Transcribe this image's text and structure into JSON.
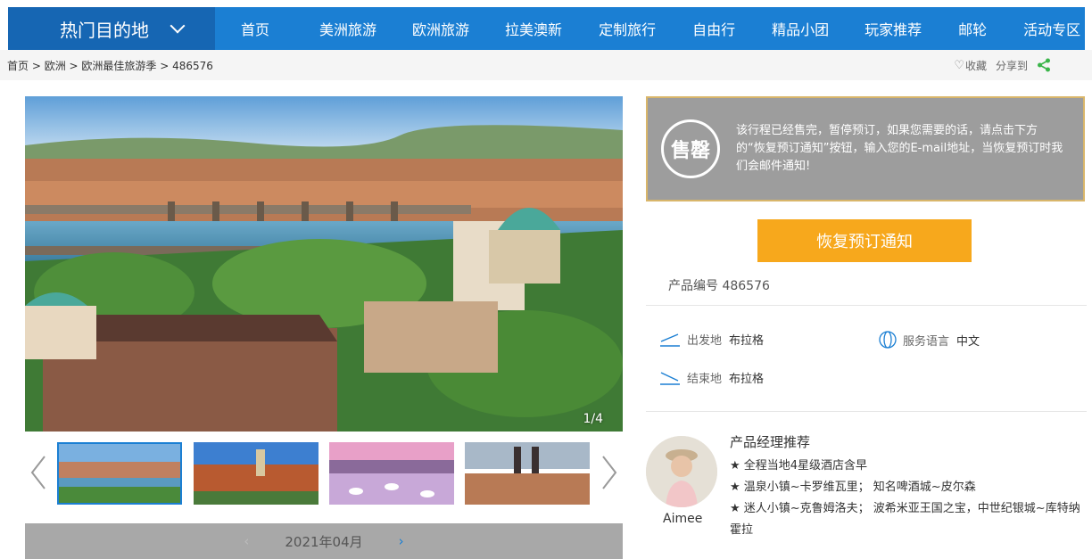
{
  "nav": {
    "brand": "热门目的地",
    "items": [
      "首页",
      "美洲旅游",
      "欧洲旅游",
      "拉美澳新",
      "定制旅行",
      "自由行",
      "精品小团",
      "玩家推荐",
      "邮轮",
      "活动专区"
    ]
  },
  "breadcrumb": {
    "home": "首页",
    "sep": " > ",
    "level1": "欧洲",
    "level2": "欧洲最佳旅游季",
    "current": "486576"
  },
  "actions": {
    "favorite": "收藏",
    "share": "分享到"
  },
  "gallery": {
    "counter": "1/4",
    "thumbnail_count": 4,
    "active_thumbnail": 1
  },
  "calendar": {
    "month": "2021年04月",
    "prev": "‹",
    "next": "›"
  },
  "soldout": {
    "stamp": "售罄",
    "message": "该行程已经售完，暂停预订，如果您需要的话，请点击下方的“恢复预订通知”按钮，输入您的E-mail地址，当恢复预订时我们会邮件通知!"
  },
  "restore_button": "恢复预订通知",
  "product": {
    "code_label": "产品编号",
    "code": "486576"
  },
  "trip": {
    "departure_label": "出发地",
    "departure": "布拉格",
    "language_label": "服务语言",
    "language": "中文",
    "end_label": "结束地",
    "end": "布拉格"
  },
  "manager": {
    "title": "产品经理推荐",
    "name": "Aimee",
    "points": [
      "★ 全程当地4星级酒店含早",
      "★ 温泉小镇~卡罗维瓦里； 知名啤酒城~皮尔森",
      "★ 迷人小镇~克鲁姆洛夫； 波希米亚王国之宝，中世纪银城~库特纳霍拉"
    ]
  },
  "colors": {
    "nav": "#1b7fd3",
    "nav_brand": "#1666b3",
    "button": "#f7a81c",
    "soldout_bg": "#9d9d9d",
    "share": "#3bb54a"
  }
}
